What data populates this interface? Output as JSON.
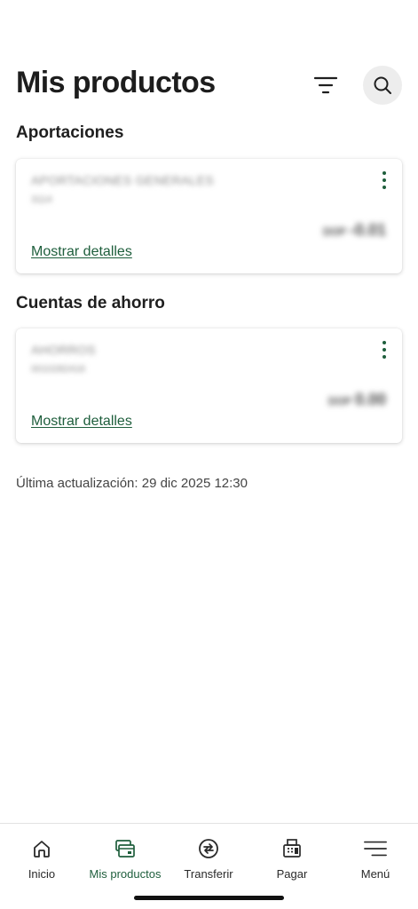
{
  "header": {
    "title": "Mis productos",
    "filter_icon": "filter-icon",
    "search_icon": "search-icon"
  },
  "sections": [
    {
      "title": "Aportaciones",
      "card": {
        "name": "APORTACIONES GENERALES",
        "number": "3114",
        "currency": "DOP",
        "amount": "-0.01",
        "details_label": "Mostrar detalles"
      }
    },
    {
      "title": "Cuentas de ahorro",
      "card": {
        "name": "AHORROS",
        "number": "0010282416",
        "currency": "DOP",
        "amount": "0.00",
        "details_label": "Mostrar detalles"
      }
    }
  ],
  "last_update": "Última actualización: 29 dic 2025 12:30",
  "nav": {
    "items": [
      {
        "label": "Inicio",
        "icon": "home-icon",
        "active": false
      },
      {
        "label": "Mis productos",
        "icon": "products-icon",
        "active": true
      },
      {
        "label": "Transferir",
        "icon": "transfer-icon",
        "active": false
      },
      {
        "label": "Pagar",
        "icon": "pay-icon",
        "active": false
      },
      {
        "label": "Menú",
        "icon": "menu-icon",
        "active": false
      }
    ]
  },
  "colors": {
    "accent": "#1e5e3c",
    "text": "#1f1f1f",
    "search_bg": "#ededed"
  }
}
